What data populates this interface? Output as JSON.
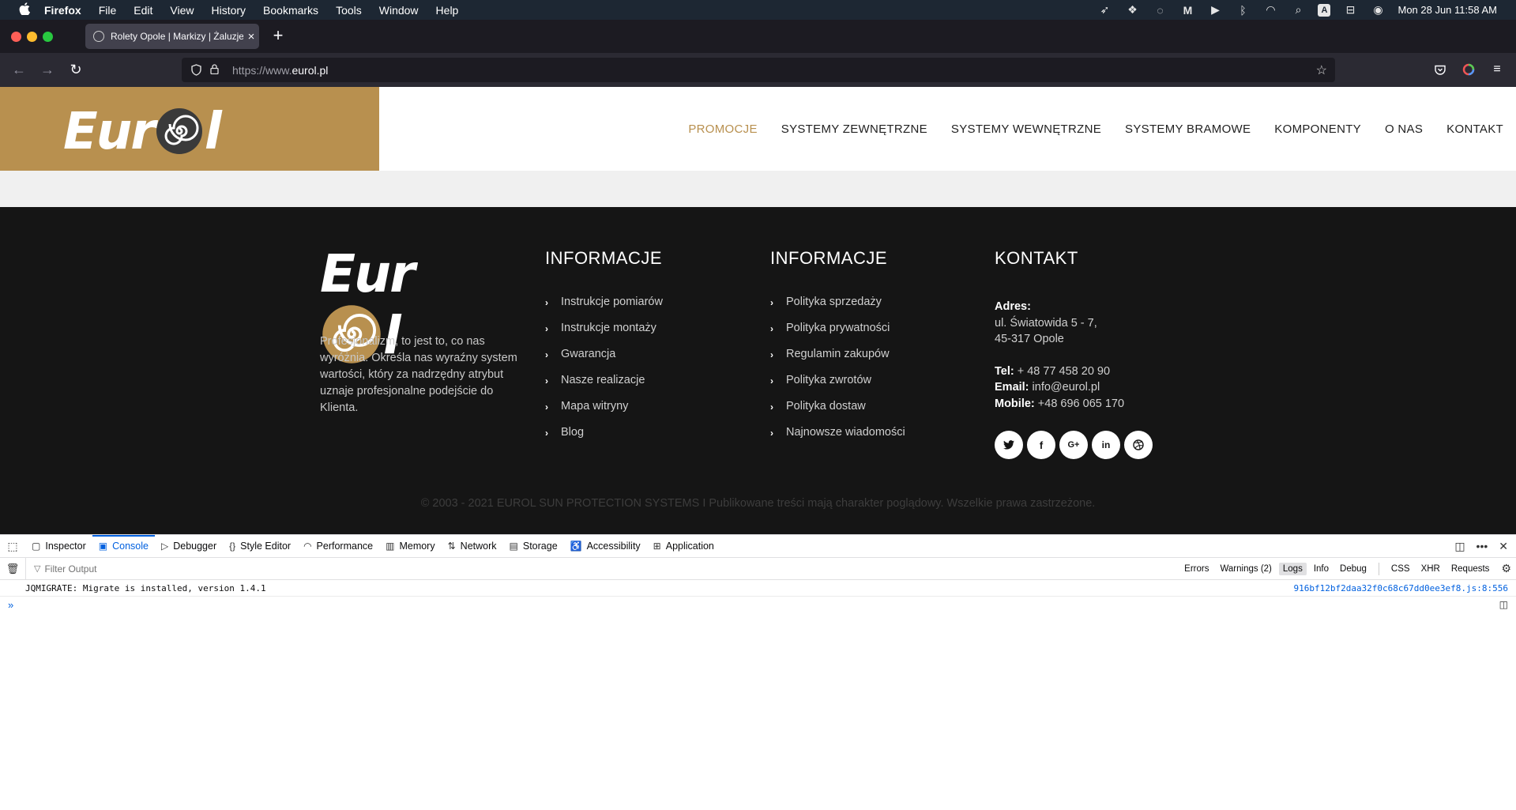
{
  "menubar": {
    "apple": "",
    "items": [
      "Firefox",
      "File",
      "Edit",
      "View",
      "History",
      "Bookmarks",
      "Tools",
      "Window",
      "Help"
    ],
    "status_icons": [
      "feather-icon",
      "dropbox-icon",
      "sync-icon",
      "m-icon",
      "play-icon",
      "bluetooth-icon",
      "wifi-icon",
      "search-icon",
      "keyboard-a-icon",
      "control-center-icon",
      "siri-icon"
    ],
    "clock": "Mon 28 Jun  11:58 AM"
  },
  "browser": {
    "tab_title": "Rolety Opole | Markizy | Żaluzje",
    "url_prefix": "https://www.",
    "url_domain": "eurol.pl"
  },
  "site": {
    "logo": "Eurol",
    "nav": [
      "PROMOCJE",
      "SYSTEMY ZEWNĘTRZNE",
      "SYSTEMY WEWNĘTRZNE",
      "SYSTEMY BRAMOWE",
      "KOMPONENTY",
      "O NAS",
      "KONTAKT"
    ],
    "accent_color": "#b8904f",
    "footer": {
      "about": "Profesjonalizm, to jest to, co nas wyróżnia. Określa nas wyraźny system wartości, który za nadrzędny atrybut uznaje profesjonalne podejście do Klienta.",
      "col1_title": "INFORMACJE",
      "col1_links": [
        "Instrukcje pomiarów",
        "Instrukcje montaży",
        "Gwarancja",
        "Nasze realizacje",
        "Mapa witryny",
        "Blog"
      ],
      "col2_title": "INFORMACJE",
      "col2_links": [
        "Polityka sprzedaży",
        "Polityka prywatności",
        "Regulamin zakupów",
        "Polityka zwrotów",
        "Polityka dostaw",
        "Najnowsze wiadomości"
      ],
      "contact_title": "KONTAKT",
      "address_label": "Adres:",
      "address_line1": "ul. Światowida 5 - 7,",
      "address_line2": "45-317 Opole",
      "tel_label": "Tel:",
      "tel": "+ 48 77 458 20 90",
      "email_label": "Email:",
      "email": "info@eurol.pl",
      "mobile_label": "Mobile:",
      "mobile": "+48 696 065 170",
      "socials": [
        "twitter-icon",
        "facebook-icon",
        "google-plus-icon",
        "linkedin-icon",
        "dribbble-icon"
      ],
      "copyright": "© 2003 - 2021 EUROL SUN PROTECTION SYSTEMS I Publikowane treści mają charakter poglądowy. Wszelkie prawa zastrzeżone."
    }
  },
  "devtools": {
    "tabs": [
      "Inspector",
      "Console",
      "Debugger",
      "Style Editor",
      "Performance",
      "Memory",
      "Network",
      "Storage",
      "Accessibility",
      "Application"
    ],
    "active_tab": "Console",
    "filter_placeholder": "Filter Output",
    "levels": [
      "Errors",
      "Warnings (2)",
      "Logs",
      "Info",
      "Debug"
    ],
    "extra_filters": [
      "CSS",
      "XHR",
      "Requests"
    ],
    "log_message": "JQMIGRATE: Migrate is installed, version 1.4.1",
    "log_source": "916bf12bf2daa32f0c68c67dd0ee3ef8.js:8:556"
  }
}
